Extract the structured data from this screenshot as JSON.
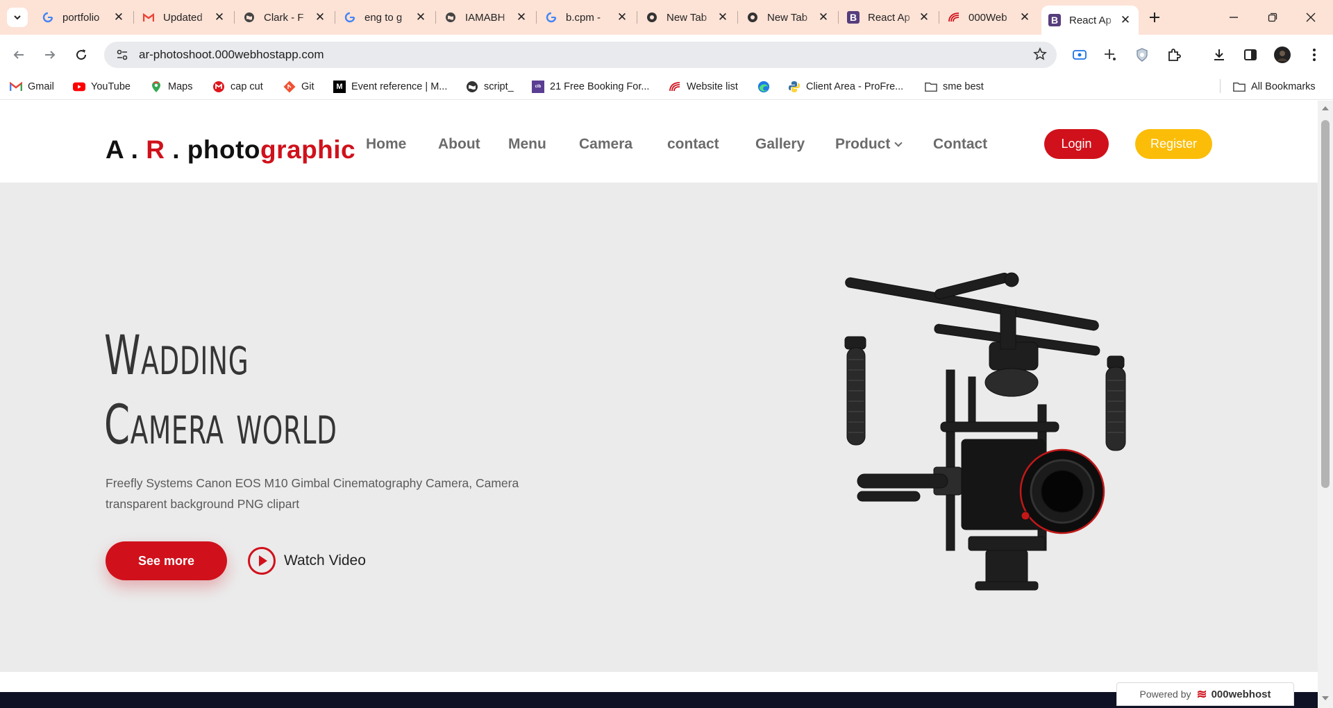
{
  "browser": {
    "tabs": [
      {
        "icon": "google-icon",
        "title": "portfolio"
      },
      {
        "icon": "gmail-icon",
        "title": "Updated"
      },
      {
        "icon": "globe-icon",
        "title": "Clark - F"
      },
      {
        "icon": "google-icon",
        "title": "eng to g"
      },
      {
        "icon": "globe-icon",
        "title": "IAMABH"
      },
      {
        "icon": "google-icon",
        "title": "b.cpm -"
      },
      {
        "icon": "chrome-icon",
        "title": "New Tab"
      },
      {
        "icon": "chrome-icon",
        "title": "New Tab"
      },
      {
        "icon": "bootstrap-icon",
        "title": "React Ap"
      },
      {
        "icon": "000webhost-icon",
        "title": "000Web"
      },
      {
        "icon": "bootstrap-icon",
        "title": "React Ap",
        "active": true
      }
    ],
    "url": "ar-photoshoot.000webhostapp.com",
    "bookmarks": [
      {
        "icon": "gmail-icon",
        "label": "Gmail"
      },
      {
        "icon": "youtube-icon",
        "label": "YouTube"
      },
      {
        "icon": "maps-icon",
        "label": "Maps"
      },
      {
        "icon": "capcut-icon",
        "label": "cap cut"
      },
      {
        "icon": "git-icon",
        "label": "Git"
      },
      {
        "icon": "mdn-icon",
        "label": "Event reference | M..."
      },
      {
        "icon": "globe-icon",
        "label": "script_"
      },
      {
        "icon": "colorlib-icon",
        "label": "21 Free Booking For..."
      },
      {
        "icon": "000webhost-icon",
        "label": "Website list"
      },
      {
        "icon": "edge-icon",
        "label": ""
      },
      {
        "icon": "python-icon",
        "label": "Client Area - ProFre..."
      },
      {
        "icon": "folder-icon",
        "label": "sme best"
      }
    ],
    "all_bookmarks": "All Bookmarks"
  },
  "site": {
    "logo": {
      "part1": "A . ",
      "part2": "R",
      "part3": " . photo",
      "part4": "graphic"
    },
    "nav": [
      "Home",
      "About",
      "Menu",
      "Camera",
      "contact",
      "Gallery",
      "Product",
      "Contact"
    ],
    "login": "Login",
    "register": "Register",
    "hero": {
      "title_line1": "Wadding",
      "title_line2": "Camera world",
      "description": "Freefly Systems Canon EOS M10 Gimbal Cinematography Camera, Camera transparent background PNG clipart",
      "see_more": "See more",
      "watch_video": "Watch Video"
    },
    "powered_by": "Powered by",
    "powered_brand": "000webhost"
  },
  "colors": {
    "brand_red": "#d0111b",
    "register_yellow": "#fbbd08",
    "hero_bg": "#ebebeb",
    "tabstrip_bg": "#fde2d6"
  }
}
